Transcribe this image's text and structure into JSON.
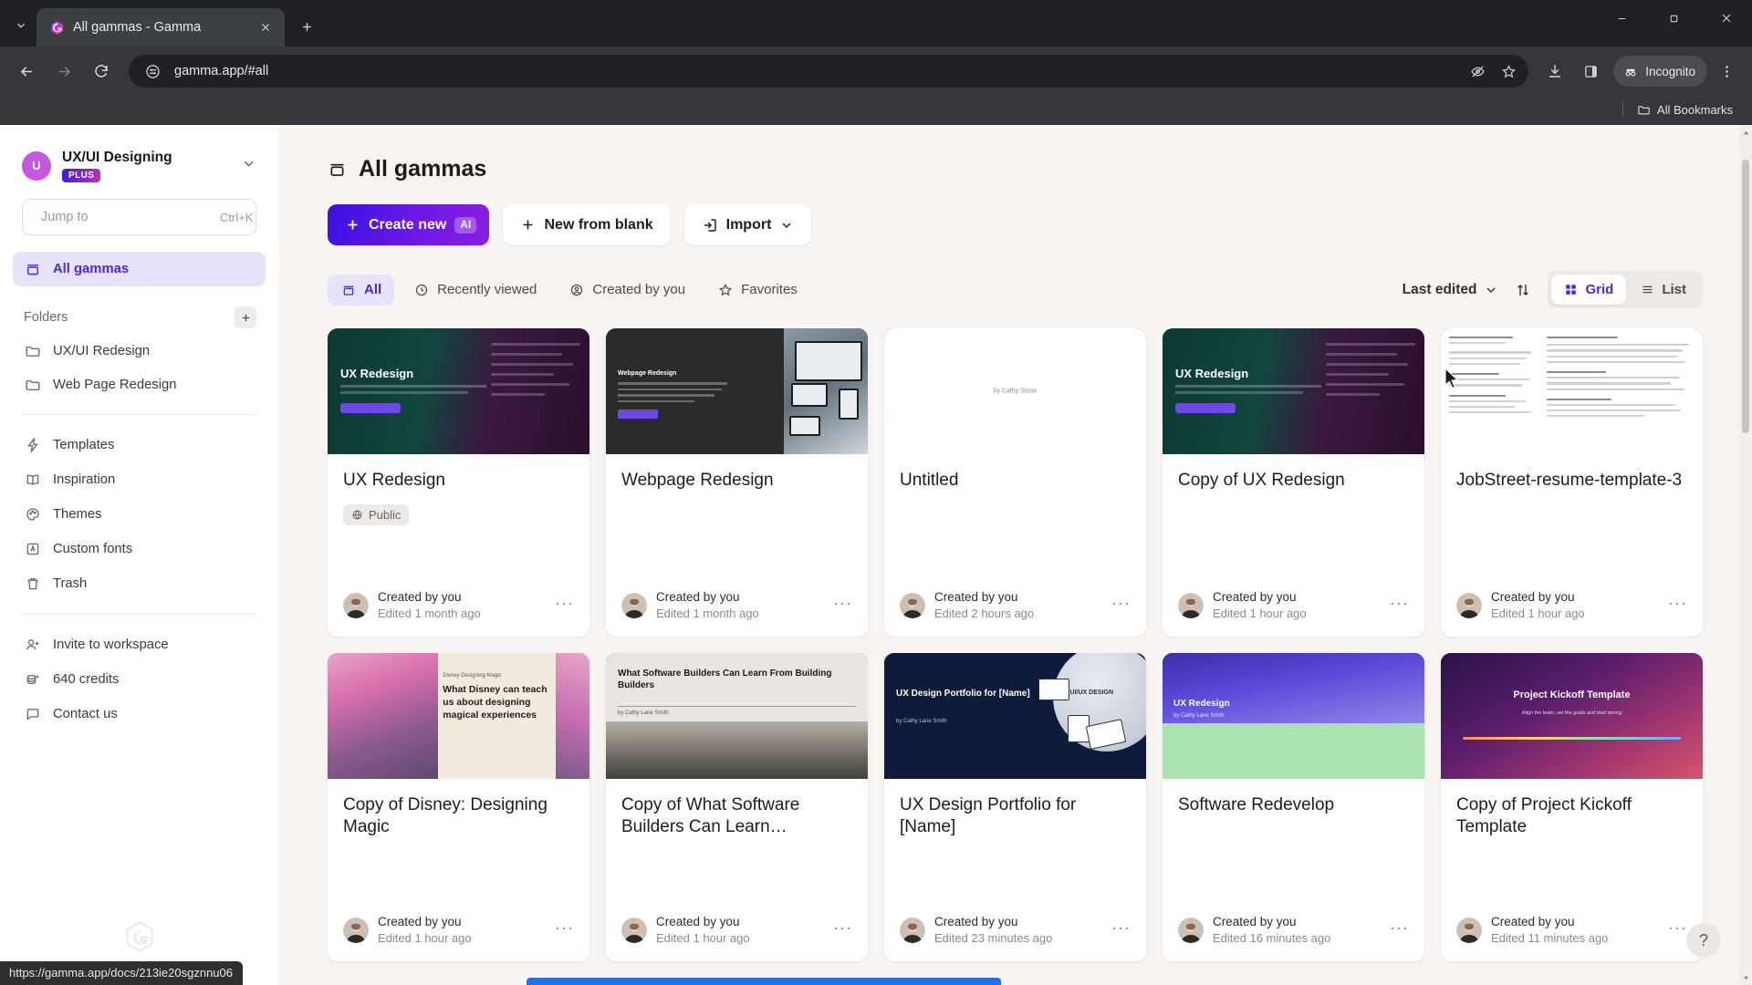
{
  "browser": {
    "tab": {
      "title": "All gammas - Gamma",
      "favicon": "gamma-logo-icon"
    },
    "new_tab_label": "+",
    "url": "gamma.app/#all",
    "incognito_label": "Incognito",
    "bookmarks_label": "All Bookmarks",
    "status_url": "https://gamma.app/docs/213ie20sgznnu06",
    "window_controls": {
      "minimize": "—",
      "maximize": "❐",
      "close": "✕"
    }
  },
  "sidebar": {
    "workspace": {
      "initial": "U",
      "name": "UX/UI Designing",
      "plan": "PLUS"
    },
    "search": {
      "placeholder": "Jump to",
      "shortcut": "Ctrl+K",
      "value": ""
    },
    "primary_nav": [
      {
        "label": "All gammas",
        "icon": "gammas-icon",
        "active": true
      }
    ],
    "folders_section": {
      "title": "Folders",
      "add_label": "+"
    },
    "folders": [
      {
        "label": "UX/UI Redesign",
        "icon": "folder-icon"
      },
      {
        "label": "Web Page Redesign",
        "icon": "folder-icon"
      }
    ],
    "tools": [
      {
        "label": "Templates",
        "icon": "bolt-icon"
      },
      {
        "label": "Inspiration",
        "icon": "book-icon"
      },
      {
        "label": "Themes",
        "icon": "palette-icon"
      },
      {
        "label": "Custom fonts",
        "icon": "font-icon"
      },
      {
        "label": "Trash",
        "icon": "trash-icon"
      }
    ],
    "footer": [
      {
        "label": "Invite to workspace",
        "icon": "user-plus-icon"
      },
      {
        "label": "640 credits",
        "icon": "coins-icon"
      },
      {
        "label": "Contact us",
        "icon": "chat-icon"
      }
    ]
  },
  "main": {
    "page_title": "All gammas",
    "actions": [
      {
        "label": "Create new",
        "chip": "AI",
        "style": "primary",
        "icon": "plus-icon"
      },
      {
        "label": "New from blank",
        "style": "white",
        "icon": "plus-icon"
      },
      {
        "label": "Import",
        "style": "white",
        "icon": "import-icon",
        "has_chevron": true
      }
    ],
    "filters": [
      {
        "label": "All",
        "icon": "gammas-icon",
        "active": true
      },
      {
        "label": "Recently viewed",
        "icon": "clock-icon",
        "active": false
      },
      {
        "label": "Created by you",
        "icon": "user-circle-icon",
        "active": false
      },
      {
        "label": "Favorites",
        "icon": "star-icon",
        "active": false
      }
    ],
    "sort": {
      "label": "Last edited",
      "direction_icon": "sort-arrows-icon"
    },
    "view_toggle": [
      {
        "label": "Grid",
        "icon": "grid-icon",
        "active": true
      },
      {
        "label": "List",
        "icon": "list-icon",
        "active": false
      }
    ],
    "cards": [
      {
        "title": "UX Redesign",
        "badge": "Public",
        "badge_icon": "globe-icon",
        "author": "Created by you",
        "edited": "Edited 1 month ago",
        "thumb": "ux",
        "thumb_title": "UX Redesign"
      },
      {
        "title": "Webpage Redesign",
        "badge": null,
        "author": "Created by you",
        "edited": "Edited 1 month ago",
        "thumb": "web",
        "thumb_title": "Webpage Redesign"
      },
      {
        "title": "Untitled",
        "badge": null,
        "author": "Created by you",
        "edited": "Edited 2 hours ago",
        "thumb": "white",
        "thumb_title": "by Cathy Stone"
      },
      {
        "title": "Copy of UX Redesign",
        "badge": null,
        "author": "Created by you",
        "edited": "Edited 1 hour ago",
        "thumb": "ux",
        "thumb_title": "UX Redesign"
      },
      {
        "title": "JobStreet-resume-template-3",
        "badge": null,
        "author": "Created by you",
        "edited": "Edited 1 hour ago",
        "thumb": "resume",
        "thumb_title": ""
      },
      {
        "title": "Copy of Disney: Designing Magic",
        "badge": null,
        "author": "Created by you",
        "edited": "Edited 1 hour ago",
        "thumb": "disney",
        "thumb_title": "What Disney can teach us about designing magical experiences"
      },
      {
        "title": "Copy of What Software Builders Can Learn…",
        "badge": null,
        "author": "Created by you",
        "edited": "Edited 1 hour ago",
        "thumb": "sw",
        "thumb_title": "What Software Builders Can Learn From Building Builders"
      },
      {
        "title": "UX Design Portfolio for [Name]",
        "badge": null,
        "author": "Created by you",
        "edited": "Edited 23 minutes ago",
        "thumb": "port",
        "thumb_title": "UX Design Portfolio for [Name]"
      },
      {
        "title": "Software Redevelop",
        "badge": null,
        "author": "Created by you",
        "edited": "Edited 16 minutes ago",
        "thumb": "soft",
        "thumb_title": "UX Redesign"
      },
      {
        "title": "Copy of Project Kickoff Template",
        "badge": null,
        "author": "Created by you",
        "edited": "Edited 11 minutes ago",
        "thumb": "kick",
        "thumb_title": "Project Kickoff Template"
      }
    ],
    "help_label": "?"
  },
  "colors": {
    "accent": "#4b28e0",
    "accent_soft": "#e6e3fb",
    "page_bg": "#f7f4f2",
    "primary_gradient_start": "#3a12e0",
    "primary_gradient_end": "#8a1fe0",
    "avatar": "#c557e0"
  }
}
